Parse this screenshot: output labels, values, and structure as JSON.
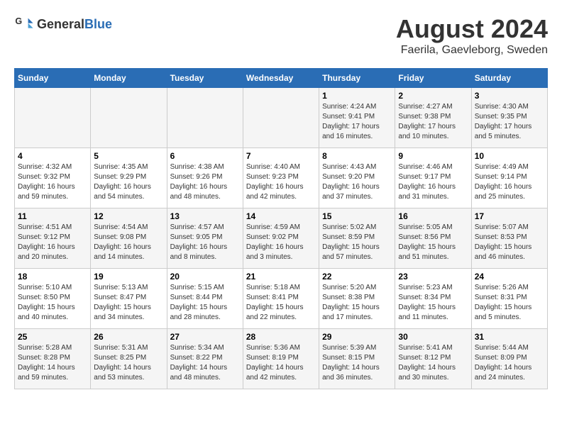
{
  "header": {
    "logo_general": "General",
    "logo_blue": "Blue",
    "month_year": "August 2024",
    "location": "Faerila, Gaevleborg, Sweden"
  },
  "weekdays": [
    "Sunday",
    "Monday",
    "Tuesday",
    "Wednesday",
    "Thursday",
    "Friday",
    "Saturday"
  ],
  "weeks": [
    [
      {
        "day": "",
        "info": ""
      },
      {
        "day": "",
        "info": ""
      },
      {
        "day": "",
        "info": ""
      },
      {
        "day": "",
        "info": ""
      },
      {
        "day": "1",
        "info": "Sunrise: 4:24 AM\nSunset: 9:41 PM\nDaylight: 17 hours\nand 16 minutes."
      },
      {
        "day": "2",
        "info": "Sunrise: 4:27 AM\nSunset: 9:38 PM\nDaylight: 17 hours\nand 10 minutes."
      },
      {
        "day": "3",
        "info": "Sunrise: 4:30 AM\nSunset: 9:35 PM\nDaylight: 17 hours\nand 5 minutes."
      }
    ],
    [
      {
        "day": "4",
        "info": "Sunrise: 4:32 AM\nSunset: 9:32 PM\nDaylight: 16 hours\nand 59 minutes."
      },
      {
        "day": "5",
        "info": "Sunrise: 4:35 AM\nSunset: 9:29 PM\nDaylight: 16 hours\nand 54 minutes."
      },
      {
        "day": "6",
        "info": "Sunrise: 4:38 AM\nSunset: 9:26 PM\nDaylight: 16 hours\nand 48 minutes."
      },
      {
        "day": "7",
        "info": "Sunrise: 4:40 AM\nSunset: 9:23 PM\nDaylight: 16 hours\nand 42 minutes."
      },
      {
        "day": "8",
        "info": "Sunrise: 4:43 AM\nSunset: 9:20 PM\nDaylight: 16 hours\nand 37 minutes."
      },
      {
        "day": "9",
        "info": "Sunrise: 4:46 AM\nSunset: 9:17 PM\nDaylight: 16 hours\nand 31 minutes."
      },
      {
        "day": "10",
        "info": "Sunrise: 4:49 AM\nSunset: 9:14 PM\nDaylight: 16 hours\nand 25 minutes."
      }
    ],
    [
      {
        "day": "11",
        "info": "Sunrise: 4:51 AM\nSunset: 9:12 PM\nDaylight: 16 hours\nand 20 minutes."
      },
      {
        "day": "12",
        "info": "Sunrise: 4:54 AM\nSunset: 9:08 PM\nDaylight: 16 hours\nand 14 minutes."
      },
      {
        "day": "13",
        "info": "Sunrise: 4:57 AM\nSunset: 9:05 PM\nDaylight: 16 hours\nand 8 minutes."
      },
      {
        "day": "14",
        "info": "Sunrise: 4:59 AM\nSunset: 9:02 PM\nDaylight: 16 hours\nand 3 minutes."
      },
      {
        "day": "15",
        "info": "Sunrise: 5:02 AM\nSunset: 8:59 PM\nDaylight: 15 hours\nand 57 minutes."
      },
      {
        "day": "16",
        "info": "Sunrise: 5:05 AM\nSunset: 8:56 PM\nDaylight: 15 hours\nand 51 minutes."
      },
      {
        "day": "17",
        "info": "Sunrise: 5:07 AM\nSunset: 8:53 PM\nDaylight: 15 hours\nand 46 minutes."
      }
    ],
    [
      {
        "day": "18",
        "info": "Sunrise: 5:10 AM\nSunset: 8:50 PM\nDaylight: 15 hours\nand 40 minutes."
      },
      {
        "day": "19",
        "info": "Sunrise: 5:13 AM\nSunset: 8:47 PM\nDaylight: 15 hours\nand 34 minutes."
      },
      {
        "day": "20",
        "info": "Sunrise: 5:15 AM\nSunset: 8:44 PM\nDaylight: 15 hours\nand 28 minutes."
      },
      {
        "day": "21",
        "info": "Sunrise: 5:18 AM\nSunset: 8:41 PM\nDaylight: 15 hours\nand 22 minutes."
      },
      {
        "day": "22",
        "info": "Sunrise: 5:20 AM\nSunset: 8:38 PM\nDaylight: 15 hours\nand 17 minutes."
      },
      {
        "day": "23",
        "info": "Sunrise: 5:23 AM\nSunset: 8:34 PM\nDaylight: 15 hours\nand 11 minutes."
      },
      {
        "day": "24",
        "info": "Sunrise: 5:26 AM\nSunset: 8:31 PM\nDaylight: 15 hours\nand 5 minutes."
      }
    ],
    [
      {
        "day": "25",
        "info": "Sunrise: 5:28 AM\nSunset: 8:28 PM\nDaylight: 14 hours\nand 59 minutes."
      },
      {
        "day": "26",
        "info": "Sunrise: 5:31 AM\nSunset: 8:25 PM\nDaylight: 14 hours\nand 53 minutes."
      },
      {
        "day": "27",
        "info": "Sunrise: 5:34 AM\nSunset: 8:22 PM\nDaylight: 14 hours\nand 48 minutes."
      },
      {
        "day": "28",
        "info": "Sunrise: 5:36 AM\nSunset: 8:19 PM\nDaylight: 14 hours\nand 42 minutes."
      },
      {
        "day": "29",
        "info": "Sunrise: 5:39 AM\nSunset: 8:15 PM\nDaylight: 14 hours\nand 36 minutes."
      },
      {
        "day": "30",
        "info": "Sunrise: 5:41 AM\nSunset: 8:12 PM\nDaylight: 14 hours\nand 30 minutes."
      },
      {
        "day": "31",
        "info": "Sunrise: 5:44 AM\nSunset: 8:09 PM\nDaylight: 14 hours\nand 24 minutes."
      }
    ]
  ]
}
